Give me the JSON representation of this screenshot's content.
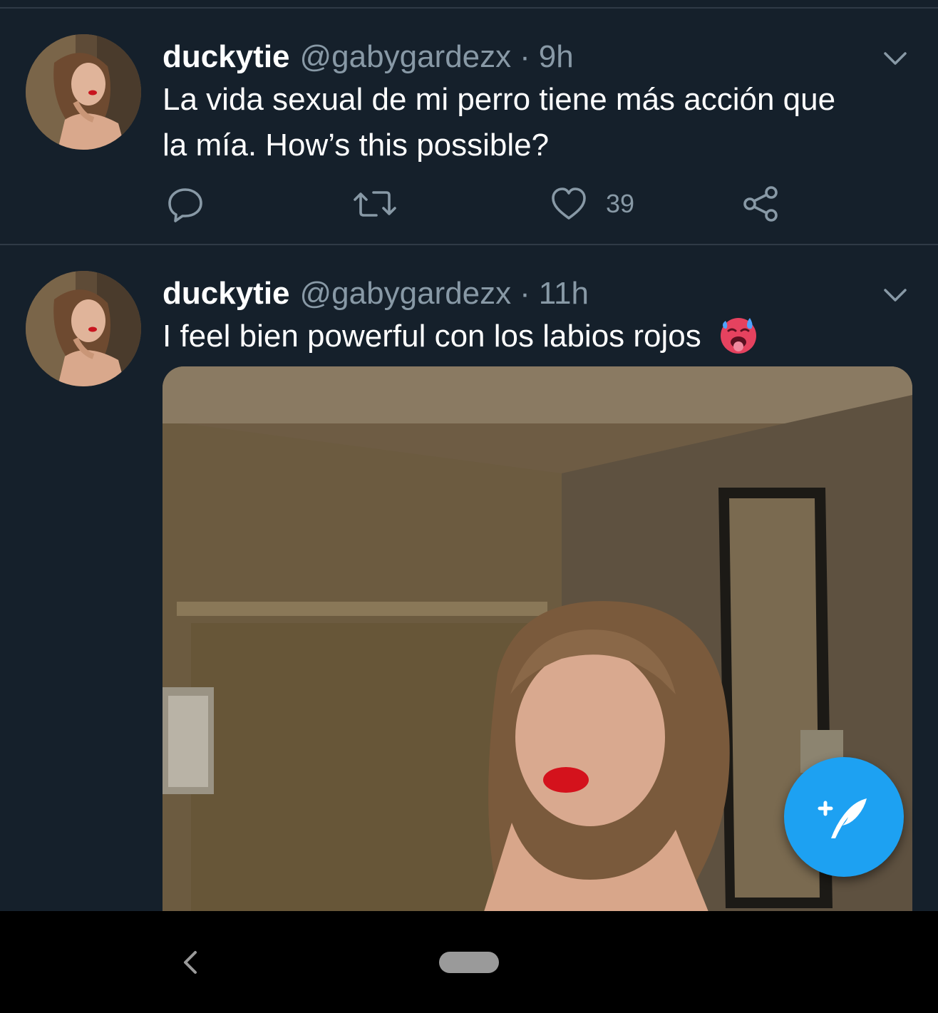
{
  "tweets": [
    {
      "display_name": "duckytie",
      "handle": "@gabygardezx",
      "separator": "·",
      "time": "9h",
      "text_line1": "La vida sexual de mi perro tiene más acción que",
      "text_line2": "la mía. How’s this possible?",
      "like_count": "39"
    },
    {
      "display_name": "duckytie",
      "handle": "@gabygardezx",
      "separator": "·",
      "time": "11h",
      "text": "I feel bien powerful con los labios rojos",
      "emoji": "hot-face-emoji",
      "media": "photo of a woman with red lipstick in a room with a mirror"
    }
  ],
  "icons": {
    "reply": "reply-icon",
    "retweet": "retweet-icon",
    "like": "heart-icon",
    "share": "share-icon",
    "caret": "chevron-down-icon",
    "compose": "compose-tweet-icon",
    "back": "back-icon"
  },
  "colors": {
    "background": "#15202b",
    "divider": "#2f3a46",
    "secondary_text": "#8899a6",
    "accent": "#1da1f2",
    "navbar": "#000000"
  }
}
